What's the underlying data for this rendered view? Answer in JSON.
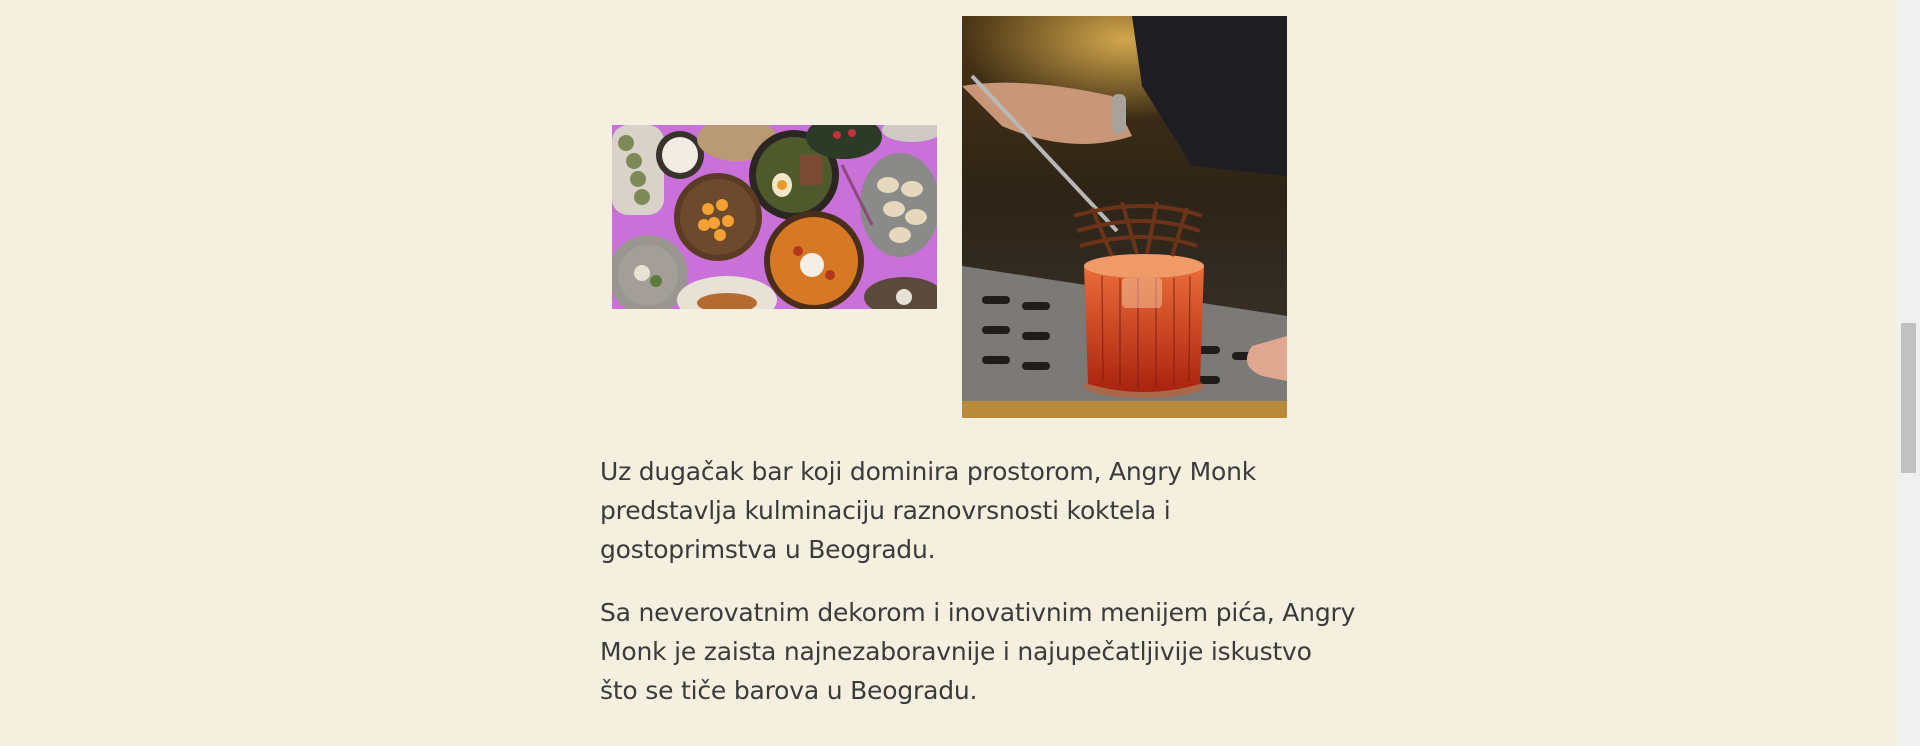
{
  "article": {
    "paragraph1": {
      "line1": "Uz dugačak bar koji dominira prostorom, Angry Monk",
      "line2": "predstavlja kulminaciju raznovrsnosti koktela i",
      "line3": "gostoprimstva u Beogradu."
    },
    "paragraph2": {
      "line1": "Sa neverovatnim dekorom i inovativnim menijem pića, Angry",
      "line2": "Monk je zaista najnezaboravnije i najupečatljivije iskustvo",
      "line3": "što se tiče barova u Beogradu."
    }
  },
  "colors": {
    "background": "#f5efe0",
    "text": "#3b3b3b",
    "food_backdrop": "#c56ad6",
    "cocktail_glow": "#d9531f"
  },
  "scroll": {
    "position_fraction": 0.55
  }
}
